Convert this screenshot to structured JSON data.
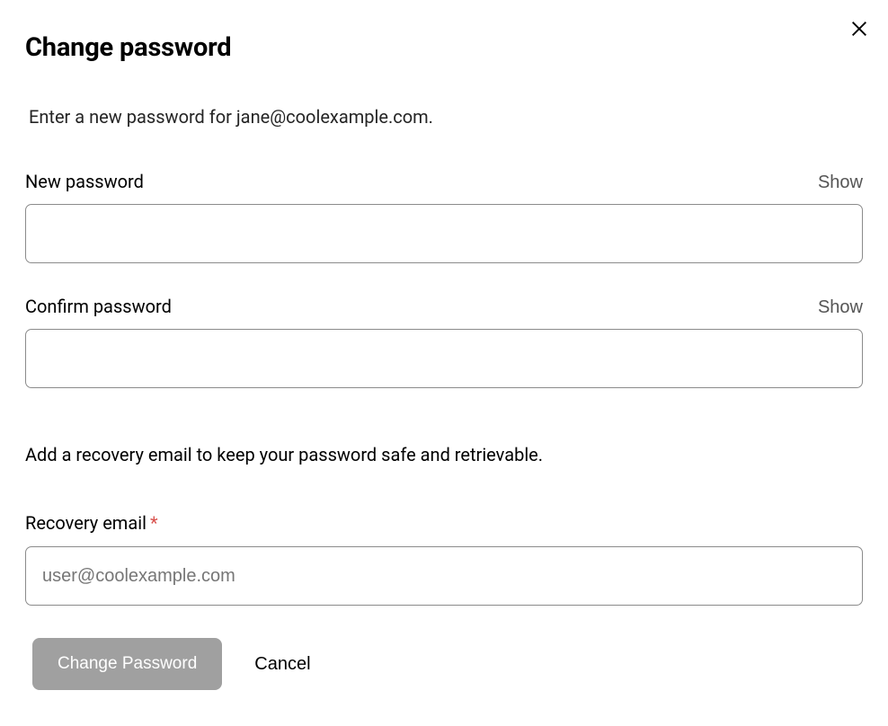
{
  "header": {
    "title": "Change password"
  },
  "instruction": "Enter a new password for jane@coolexample.com.",
  "fields": {
    "new_password": {
      "label": "New password",
      "show_label": "Show",
      "value": ""
    },
    "confirm_password": {
      "label": "Confirm password",
      "show_label": "Show",
      "value": ""
    },
    "recovery_email": {
      "label": "Recovery email",
      "required_mark": "*",
      "placeholder": "user@coolexample.com",
      "value": ""
    }
  },
  "recovery_instruction": "Add a recovery email to keep your password safe and retrievable.",
  "buttons": {
    "submit": "Change Password",
    "cancel": "Cancel"
  }
}
